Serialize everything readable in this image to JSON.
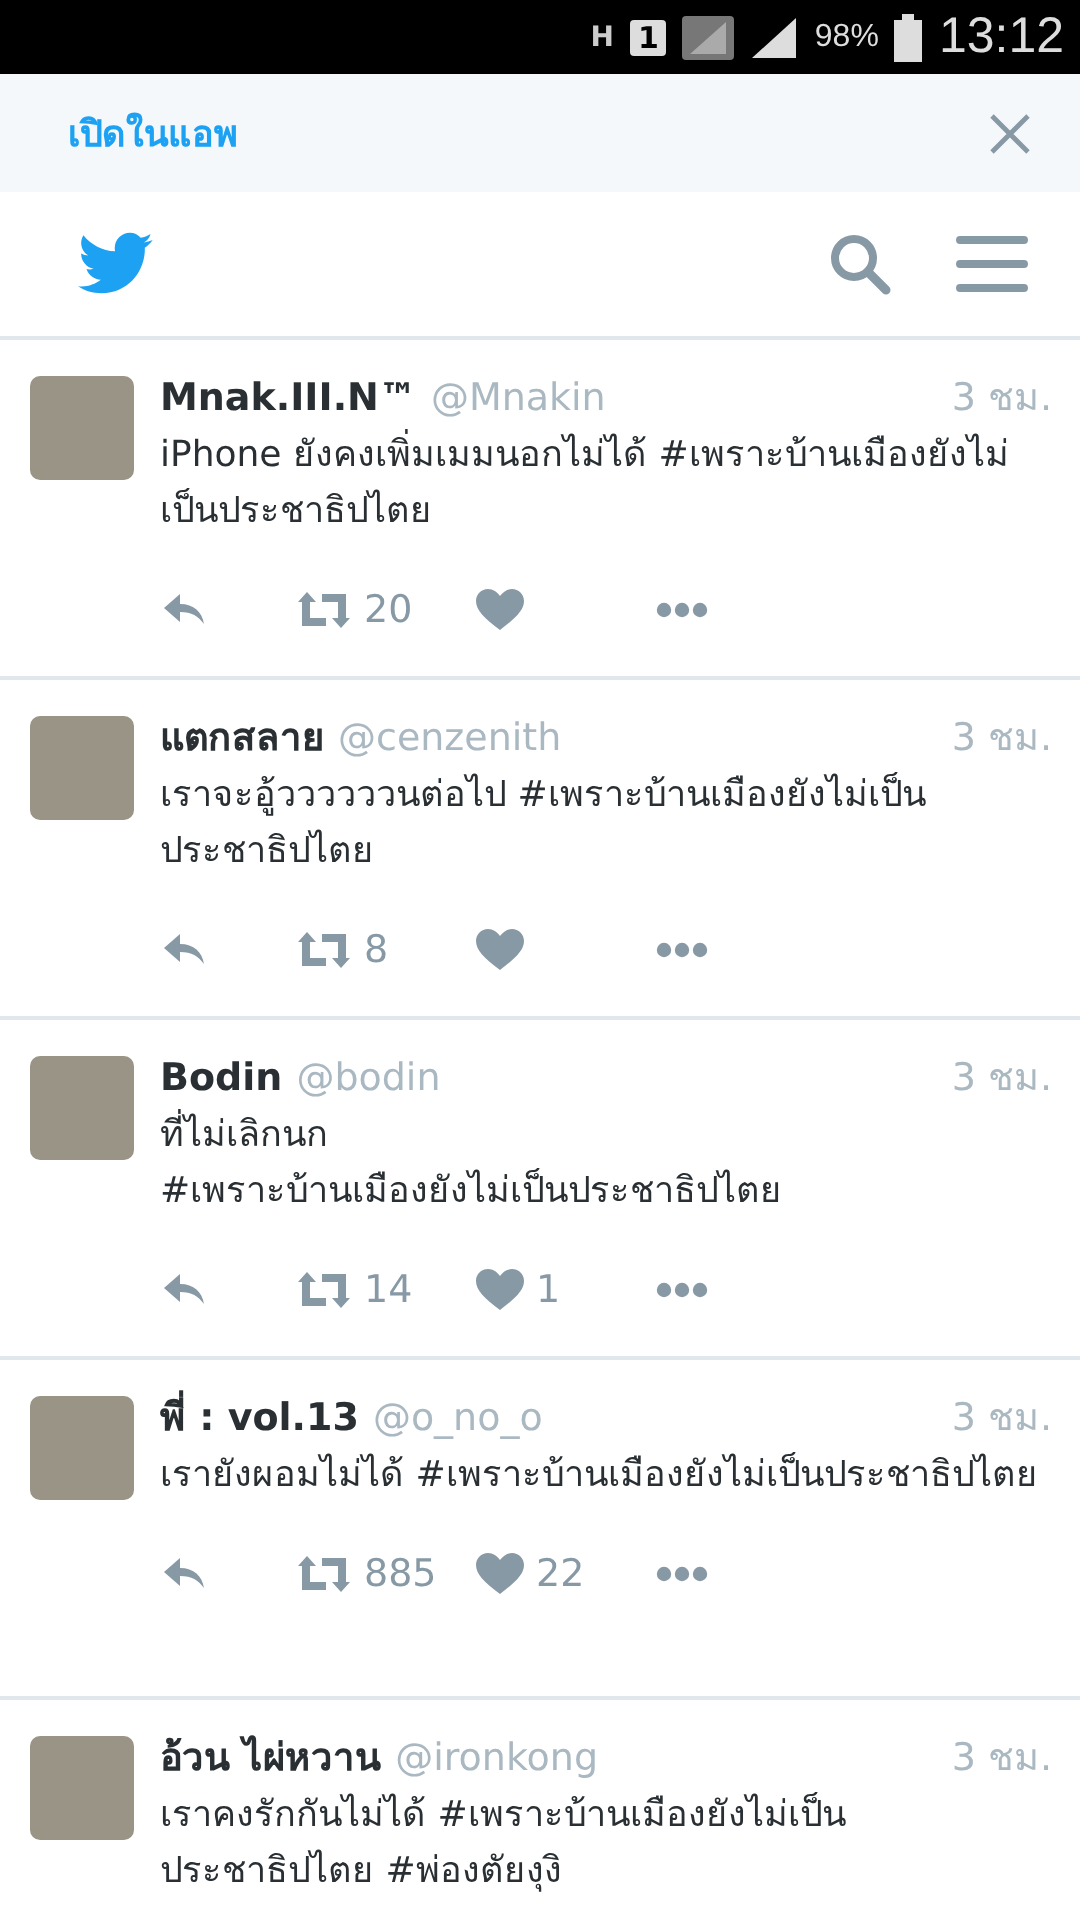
{
  "status_bar": {
    "network_type": "H",
    "sim": "1",
    "battery": "98%",
    "time": "13:12"
  },
  "banner": {
    "label": "เปิดในแอพ"
  },
  "tweets": [
    {
      "name": "Mnak.III.N™",
      "handle": "@Mnakin",
      "time": "3 ชม.",
      "text": "iPhone ยังคงเพิ่มเมมนอกไม่ได้ #เพราะบ้านเมืองยังไม่เป็นประชาธิปไตย",
      "actions": {
        "retweets": "20"
      }
    },
    {
      "name": "แตกสลาย",
      "handle": "@cenzenith",
      "time": "3 ชม.",
      "text": "เราจะอู้ววววววนต่อไป #เพราะบ้านเมืองยังไม่เป็นประชาธิปไตย",
      "actions": {
        "retweets": "8"
      }
    },
    {
      "name": "Bodin",
      "handle": "@bodin",
      "time": "3 ชม.",
      "text": "ที่ไม่เลิกนก\n#เพราะบ้านเมืองยังไม่เป็นประชาธิปไตย",
      "actions": {
        "retweets": "14",
        "likes": "1"
      }
    },
    {
      "name": "พี่ : vol.13",
      "handle": "@o_no_o",
      "time": "3 ชม.",
      "text": "เรายังผอมไม่ได้ #เพราะบ้านเมืองยังไม่เป็นประชาธิปไตย",
      "actions": {
        "retweets": "885",
        "likes": "22"
      }
    },
    {
      "name": "อ้วน ไผ่หวาน",
      "handle": "@ironkong",
      "time": "3 ชม.",
      "text": "เราคงรักกันไม่ได้ #เพราะบ้านเมืองยังไม่เป็นประชาธิปไตย #พ่องตัยงุงิ"
    }
  ]
}
